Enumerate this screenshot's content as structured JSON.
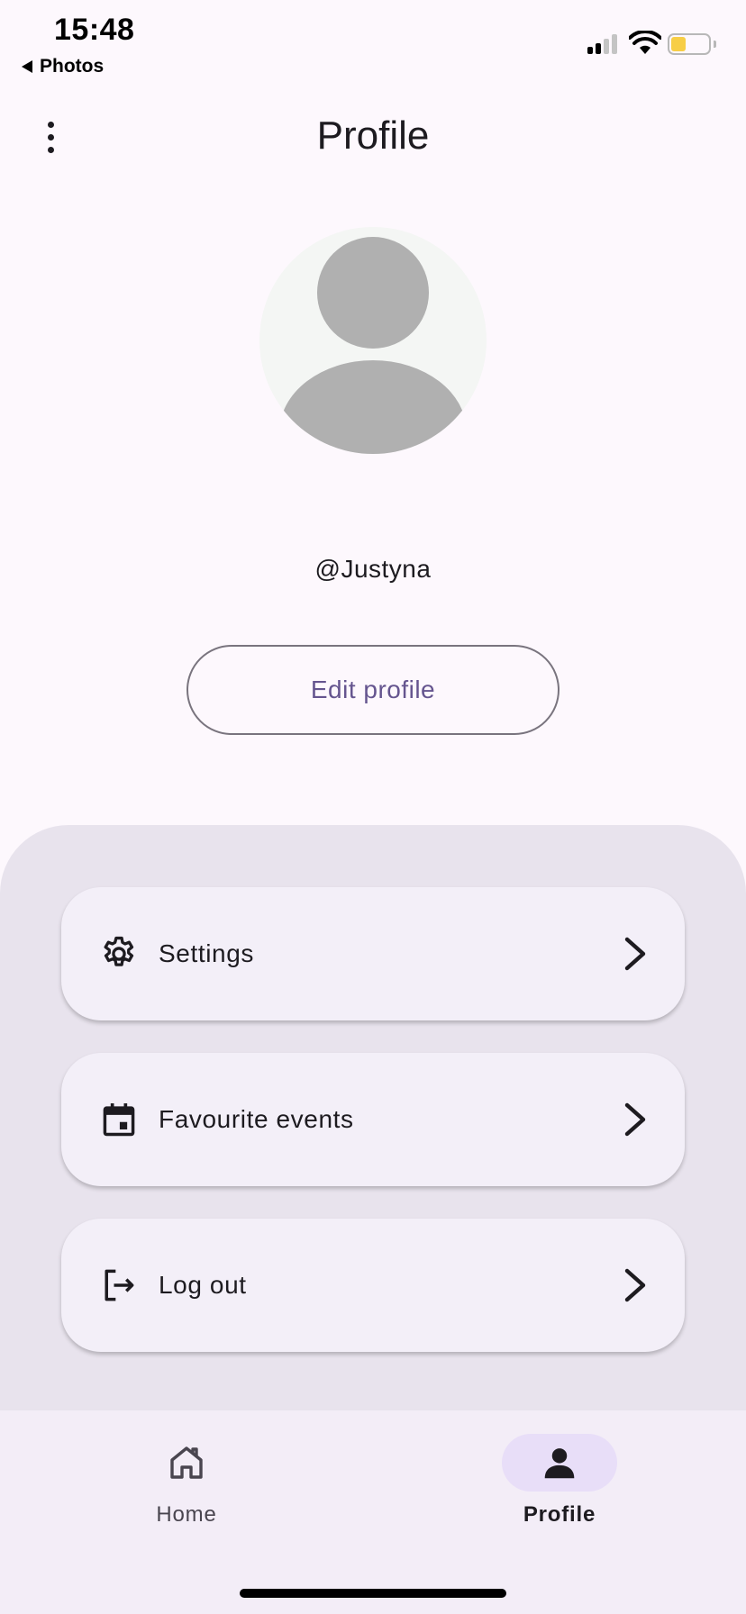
{
  "status_bar": {
    "time": "15:48",
    "back_label": "Photos",
    "battery_color": "#f7ce46"
  },
  "app_bar": {
    "title": "Profile",
    "more_icon": "more-vert-icon"
  },
  "profile": {
    "avatar_icon": "default-avatar-icon",
    "username": "@Justyna",
    "edit_button_label": "Edit profile"
  },
  "menu": {
    "items": [
      {
        "label": "Settings",
        "icon": "gear-icon"
      },
      {
        "label": "Favourite events",
        "icon": "calendar-icon"
      },
      {
        "label": "Log out",
        "icon": "logout-icon"
      }
    ]
  },
  "bottom_nav": {
    "items": [
      {
        "label": "Home",
        "icon": "home-icon",
        "active": false
      },
      {
        "label": "Profile",
        "icon": "person-icon",
        "active": true
      }
    ]
  },
  "colors": {
    "accent": "#65558f",
    "surface": "#fdf8fd",
    "sheet": "#e8e3ed",
    "card": "#f3eff8",
    "nav_active_indicator": "#e8def8"
  }
}
